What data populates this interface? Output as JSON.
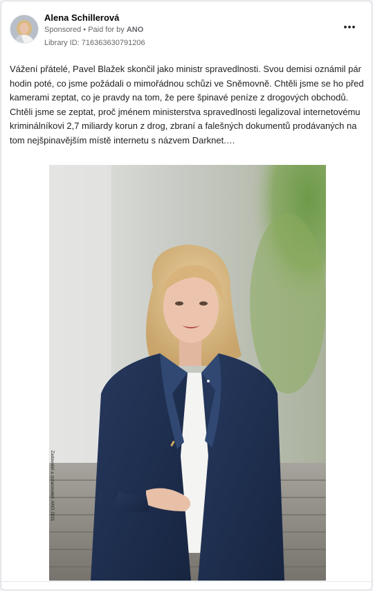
{
  "post": {
    "author": "Alena Schillerová",
    "sponsored": "Sponsored",
    "separator": "•",
    "paid_for_by_label": "Paid for by",
    "paid_for_by": "ANO",
    "library_id": "Library ID: 716363630791206",
    "more_icon": "more-horizontal-icon",
    "text": "Vážení přátelé, Pavel Blažek skončil jako ministr spravedlnosti. Svou demisi oznámil pár hodin poté, co jsme požádali o mimořádnou schůzi ve Sněmovně. Chtěli jsme se ho před kamerami zeptat, co je pravdy na tom, že pere špinavé peníze z drogových obchodů. Chtěli jsme se zeptat, proč jménem ministerstva spravedlnosti legalizoval internetovému kriminálníkovi 2,7 miliardy korun z drog, zbraní a falešných dokumentů prodávaných na tom nejšpinavějším místě internetu s názvem Darknet.…",
    "image_caption_vertical": "Zadavatel a zpracovatel: ANO 2011"
  },
  "colors": {
    "card_bg": "#ffffff",
    "meta_text": "#65676b",
    "blazer": "#1f3150",
    "hair": "#d9b982"
  }
}
